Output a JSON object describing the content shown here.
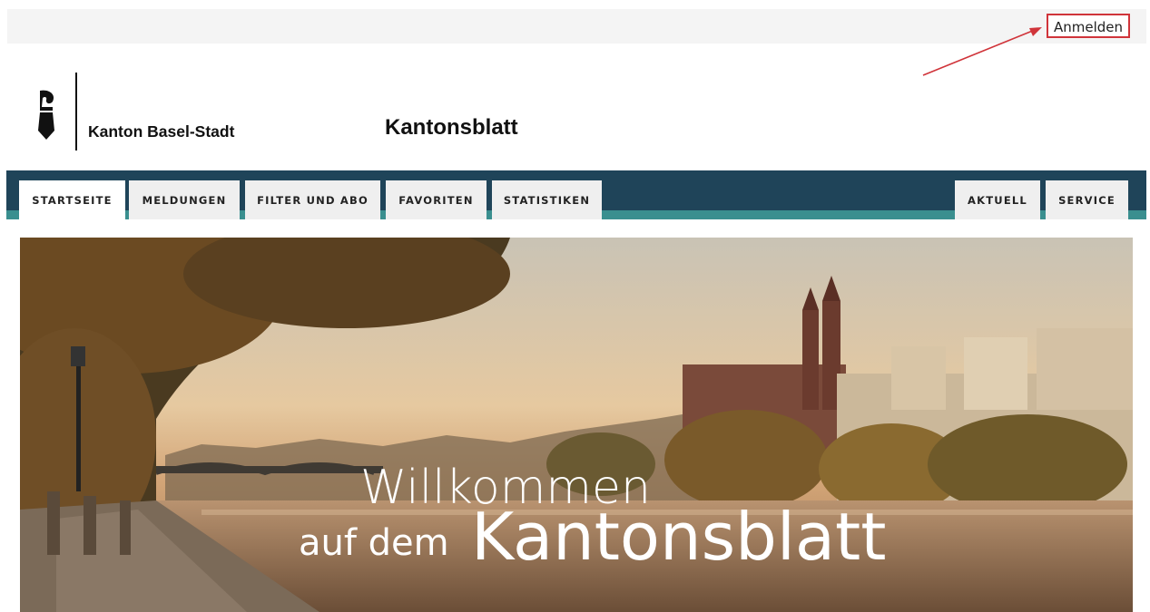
{
  "topbar": {
    "login_label": "Anmelden"
  },
  "brand": {
    "canton": "Kanton Basel-Stadt",
    "site_title": "Kantonsblatt"
  },
  "nav": {
    "left_tabs": [
      {
        "label": "STARTSEITE",
        "active": true
      },
      {
        "label": "MELDUNGEN",
        "active": false
      },
      {
        "label": "FILTER UND ABO",
        "active": false
      },
      {
        "label": "FAVORITEN",
        "active": false
      },
      {
        "label": "STATISTIKEN",
        "active": false
      }
    ],
    "right_tabs": [
      {
        "label": "AKTUELL"
      },
      {
        "label": "SERVICE"
      }
    ]
  },
  "hero": {
    "line1": "Willkommen",
    "line2_small": "auf dem",
    "line2_large": "Kantonsblatt"
  },
  "colors": {
    "nav_dark": "#1f4459",
    "nav_accent": "#3a8f8f",
    "annotation_red": "#d0343a"
  }
}
